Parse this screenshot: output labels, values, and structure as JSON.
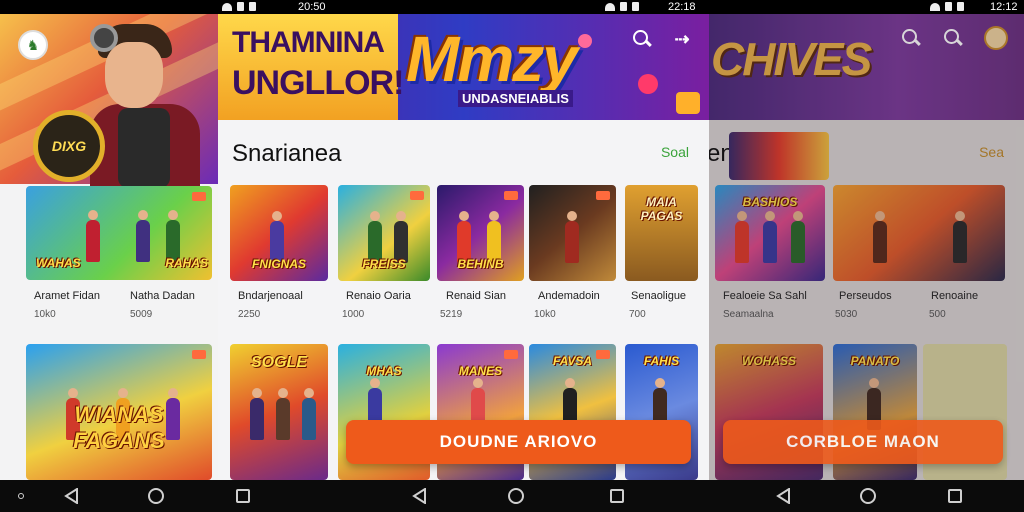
{
  "status_bar": {
    "time_mid": "20:50",
    "time_right": "22:18",
    "time_far": "12:12"
  },
  "left_panel": {
    "hero_badge": "DIXG",
    "tiles": [
      {
        "title": "WAHAS",
        "name": "Aramet Fidan",
        "meta": "10k0"
      },
      {
        "title": "RAHAS",
        "name": "Natha Dadan",
        "meta": "5009"
      },
      {
        "title": "WIANAS FAGANS",
        "name": "",
        "meta": ""
      }
    ]
  },
  "mid_panel": {
    "banner_line1": "THAMNINA",
    "banner_line2": "UNGLLOR!",
    "banner_logo": "Mmzy",
    "banner_sub": "UNDASNEIABLIS",
    "section_title": "Snarianea",
    "see_all": "Soal",
    "row1": [
      {
        "title": "FNIGNAS",
        "name": "Bndarjenoaal",
        "meta": "2250"
      },
      {
        "title": "FREISS",
        "name": "Renaio Oaria",
        "meta": "1000"
      },
      {
        "title": "BEHINB",
        "name": "Renaid Sian",
        "meta": "5219"
      },
      {
        "title": "",
        "name": "Andemadoin",
        "meta": "10k0"
      },
      {
        "title": "MAIA PAGAS",
        "name": "Senaoligue",
        "meta": "700"
      }
    ],
    "row2": [
      {
        "title": "SOGLE"
      },
      {
        "title": "MHAS"
      },
      {
        "title": "MANES"
      },
      {
        "title": "FAVSA"
      },
      {
        "title": "FAHIS"
      }
    ],
    "cta": "DOUDNE ARIOVO"
  },
  "right_panel": {
    "banner_logo": "CHIVES",
    "section_title": "en",
    "see_all": "Sea",
    "row1": [
      {
        "title": "BASHIOS",
        "name": "Fealoeie Sa Sahl",
        "meta": "Seamaalna"
      },
      {
        "title": "",
        "name": "Perseudos",
        "meta": "5030"
      },
      {
        "title": "",
        "name": "Renoaine",
        "meta": "500"
      }
    ],
    "row2": [
      {
        "title": "WOHASS"
      },
      {
        "title": "PANATO"
      }
    ],
    "cta": "CORBLOE MAON"
  },
  "icons": {
    "search": "search-icon",
    "share": "share-icon",
    "avatar": "avatar-icon",
    "back": "back-icon",
    "home": "home-icon",
    "recents": "recents-icon"
  },
  "colors": {
    "accent": "#ee5a1b",
    "see_all": "#3aa33a"
  }
}
